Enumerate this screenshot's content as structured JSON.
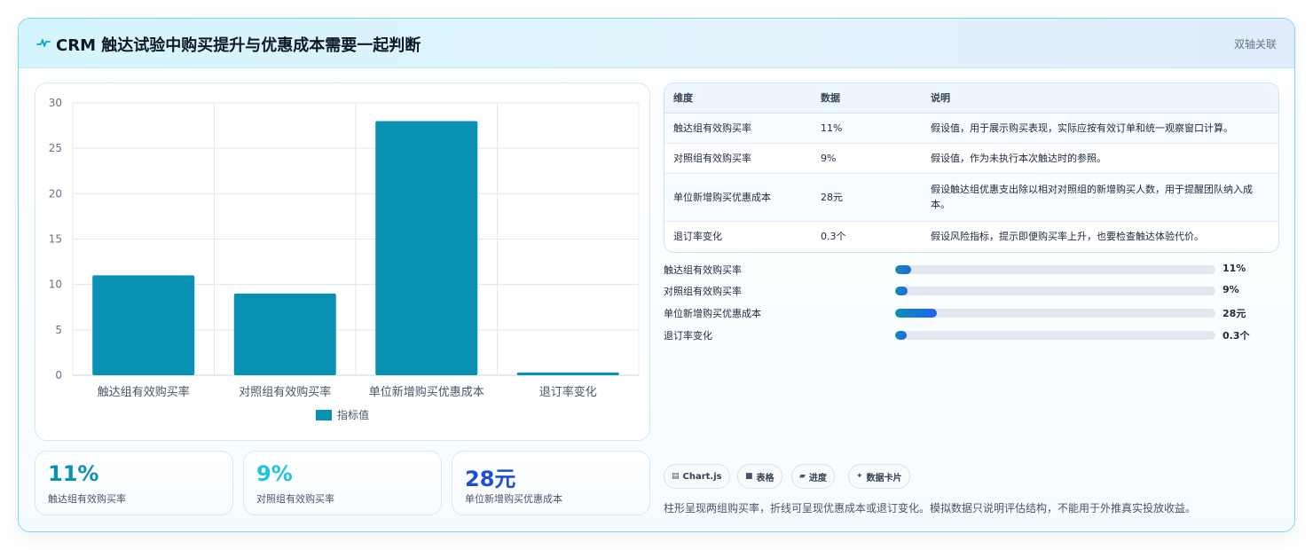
{
  "header": {
    "title": "CRM 触达试验中购买提升与优惠成本需要一起判断",
    "badge": "双轴关联",
    "icon": "pulse-icon"
  },
  "chart_data": {
    "type": "bar",
    "categories": [
      "触达组有效购买率",
      "对照组有效购买率",
      "单位新增购买优惠成本",
      "退订率变化"
    ],
    "series": [
      {
        "name": "指标值",
        "values": [
          11,
          9,
          28,
          0.3
        ],
        "color": "#0891b2"
      }
    ],
    "yticks": [
      0,
      5,
      10,
      15,
      20,
      25,
      30
    ],
    "ylim": [
      0,
      30
    ],
    "grid": true,
    "legend": "bottom"
  },
  "stats": [
    {
      "value": "11%",
      "label": "触达组有效购买率",
      "color": "#0891b2"
    },
    {
      "value": "9%",
      "label": "对照组有效购买率",
      "color": "#22c3dd"
    },
    {
      "value": "28元",
      "label": "单位新增购买优惠成本",
      "color": "#1d4ed8"
    }
  ],
  "table": {
    "headers": [
      "维度",
      "数据",
      "说明"
    ],
    "rows": [
      [
        "触达组有效购买率",
        "11%",
        "假设值，用于展示购买表现，实际应按有效订单和统一观察窗口计算。"
      ],
      [
        "对照组有效购买率",
        "9%",
        "假设值，作为未执行本次触达时的参照。"
      ],
      [
        "单位新增购买优惠成本",
        "28元",
        "假设触达组优惠支出除以相对对照组的新增购买人数，用于提醒团队纳入成本。"
      ],
      [
        "退订率变化",
        "0.3个",
        "假设风险指标，提示即便购买率上升，也要检查触达体验代价。"
      ]
    ]
  },
  "progress": [
    {
      "label": "触达组有效购买率",
      "value": "11%",
      "fraction": 0.05
    },
    {
      "label": "对照组有效购买率",
      "value": "9%",
      "fraction": 0.04
    },
    {
      "label": "单位新增购买优惠成本",
      "value": "28元",
      "fraction": 0.13
    },
    {
      "label": "退订率变化",
      "value": "0.3个",
      "fraction": 0.035
    }
  ],
  "chips": [
    {
      "icon": "chart-icon",
      "glyph": "▤",
      "label": "Chart.js"
    },
    {
      "icon": "table-icon",
      "glyph": "■",
      "label": "表格"
    },
    {
      "icon": "progress-icon",
      "glyph": "▰",
      "label": "进度"
    },
    {
      "icon": "sparkle-icon",
      "glyph": "✦",
      "label": "数据卡片"
    }
  ],
  "footnote": "柱形呈现两组购买率，折线可呈现优惠成本或退订变化。模拟数据只说明评估结构，不能用于外推真实投放收益。"
}
